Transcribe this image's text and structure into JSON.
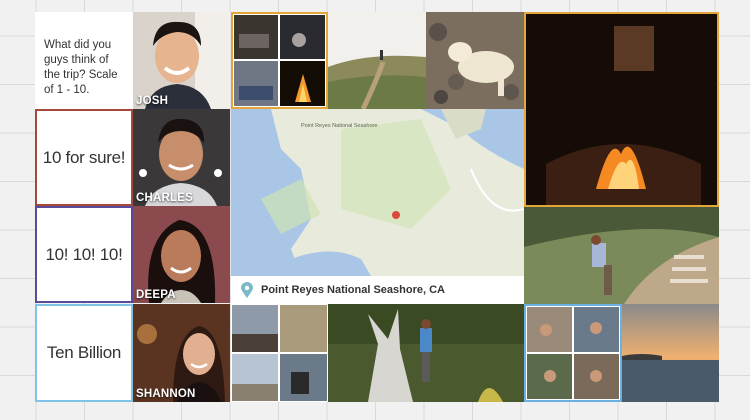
{
  "messages": [
    {
      "text": "What did you guys think of the trip? Scale of 1 - 10.",
      "border": "#ffffff",
      "user": "JOSH"
    },
    {
      "text": "10 for sure!",
      "border": "#a54a3a",
      "user": "CHARLES"
    },
    {
      "text": "10! 10! 10!",
      "border": "#5a4a9a",
      "user": "DEEPA"
    },
    {
      "text": "Ten Billion",
      "border": "#7fc4e6",
      "user": "SHANNON"
    }
  ],
  "map": {
    "location_label": "Point Reyes National Seashore, CA",
    "place_label": "Point Reyes National Seashore",
    "icon": "map-pin-icon"
  },
  "colors": {
    "map_water": "#a9c6e6",
    "map_land": "#e8eadc",
    "map_green": "#cfe2b4",
    "pin": "#7ab9c7",
    "accent_orange": "#e2a63a",
    "accent_blue": "#6ab0e0"
  }
}
